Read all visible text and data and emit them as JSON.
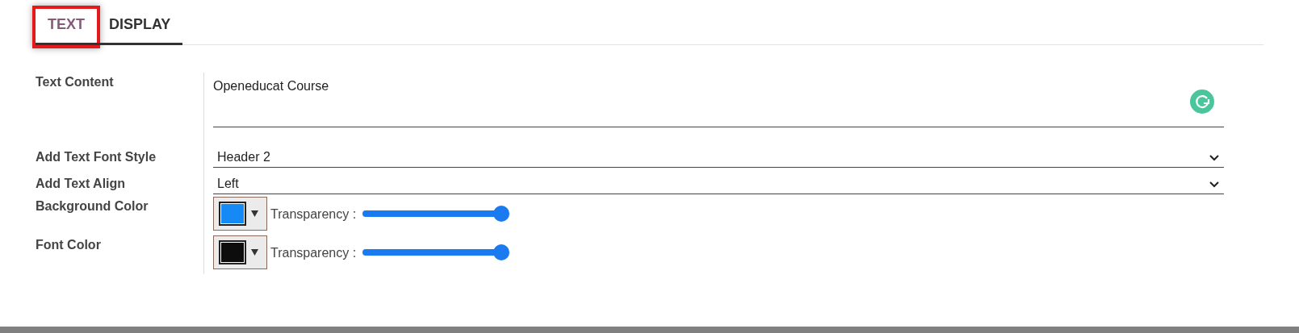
{
  "tabs": [
    {
      "label": "TEXT",
      "selected": true,
      "highlighted": true
    },
    {
      "label": "DISPLAY",
      "selected": false,
      "highlighted": false
    }
  ],
  "fields": [
    {
      "kind": "textarea",
      "label": "Text Content",
      "value": "Openeducat Course"
    },
    {
      "kind": "select",
      "label": "Add Text Font Style",
      "value": "Header 2"
    },
    {
      "kind": "select",
      "label": "Add Text Align",
      "value": "Left"
    },
    {
      "kind": "color",
      "label": "Background Color",
      "color": "#1589f5",
      "slider_label": "Transparency :",
      "level": 1
    },
    {
      "kind": "color",
      "label": "Font Color",
      "color": "#0d0d0d",
      "slider_label": "Transparency :",
      "level": 1
    }
  ]
}
